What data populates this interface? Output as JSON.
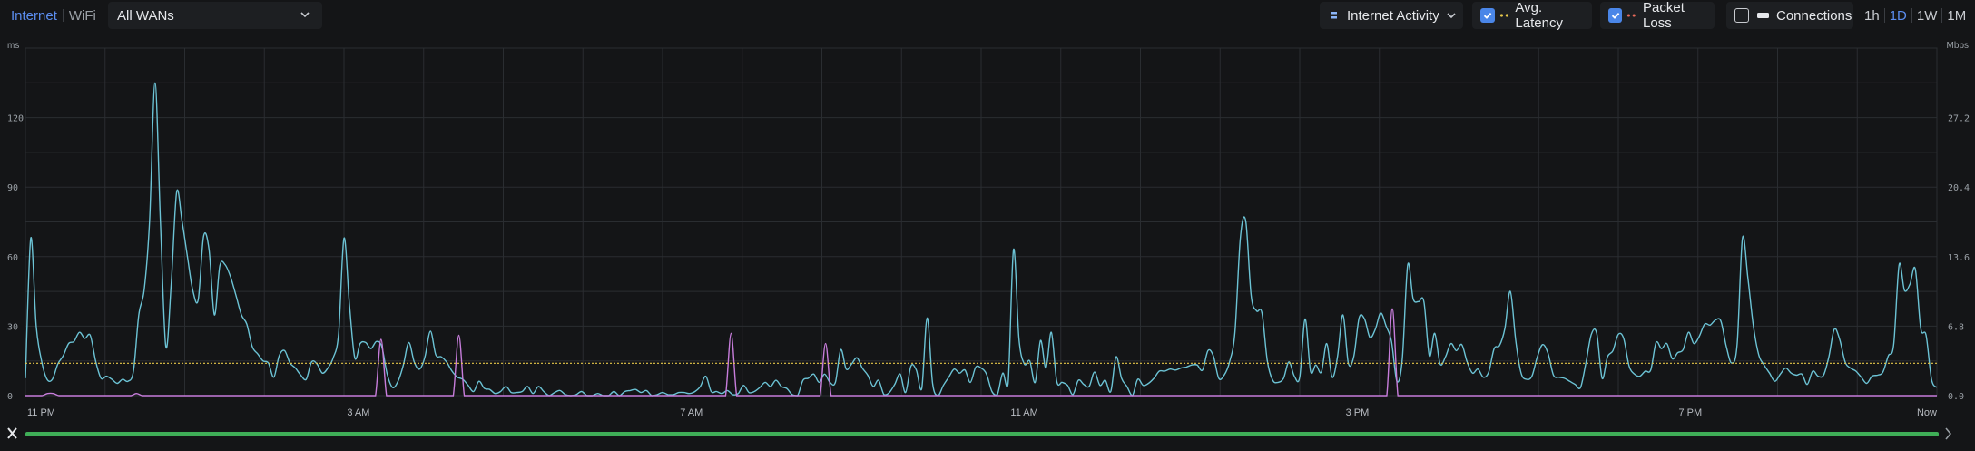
{
  "tabs": [
    {
      "label": "Internet",
      "active": true
    },
    {
      "label": "WiFi",
      "active": false
    }
  ],
  "wan_select": {
    "value": "All WANs"
  },
  "view_select": {
    "value": "Internet Activity"
  },
  "toggles": [
    {
      "label": "Avg. Latency",
      "checked": true,
      "marker_color": "#e8c94a"
    },
    {
      "label": "Packet Loss",
      "checked": true,
      "marker_color": "#e86a5a"
    },
    {
      "label": "Connections",
      "checked": false,
      "marker_color": "#e6e8eb"
    }
  ],
  "ranges": [
    {
      "label": "1h",
      "active": false
    },
    {
      "label": "1D",
      "active": true
    },
    {
      "label": "1W",
      "active": false
    },
    {
      "label": "1M",
      "active": false
    }
  ],
  "chart_data": {
    "type": "line",
    "left_axis": {
      "unit": "ms",
      "ticks": [
        "0",
        "30",
        "60",
        "90",
        "120"
      ],
      "range": [
        0,
        150
      ]
    },
    "right_axis": {
      "unit": "Mbps",
      "ticks": [
        "0.0",
        "6.8",
        "13.6",
        "20.4",
        "27.2"
      ],
      "range": [
        0,
        34
      ]
    },
    "x_axis": {
      "labels": [
        "11 PM",
        "3 AM",
        "7 AM",
        "11 AM",
        "3 PM",
        "7 PM",
        "Now"
      ]
    },
    "grid": true,
    "series": [
      {
        "color": "#6cc3d5",
        "axis": "right",
        "values": [
          1.7,
          15.4,
          6.8,
          3.4,
          1.6,
          1.6,
          3.1,
          3.9,
          5.1,
          5.3,
          6.2,
          5.6,
          5.9,
          3.4,
          1.7,
          1.9,
          1.6,
          1.2,
          1.6,
          1.4,
          2.4,
          7.9,
          10.4,
          17.1,
          30.6,
          17.1,
          4.8,
          10.9,
          19.9,
          17.1,
          13.6,
          10.3,
          9.4,
          15.6,
          14.3,
          7.9,
          12.7,
          12.8,
          11.6,
          9.8,
          7.9,
          7.0,
          4.8,
          4.1,
          3.4,
          3.2,
          1.8,
          3.9,
          4.4,
          3.2,
          2.7,
          2.0,
          1.6,
          3.3,
          3.1,
          2.2,
          2.7,
          3.7,
          6.1,
          15.4,
          9.0,
          3.7,
          5.1,
          5.2,
          4.6,
          5.3,
          4.8,
          2.1,
          0.8,
          1.4,
          3.0,
          5.2,
          3.3,
          2.6,
          3.8,
          6.3,
          4.0,
          3.8,
          3.3,
          2.4,
          1.8,
          1.6,
          1.0,
          0.4,
          1.4,
          0.7,
          0.6,
          0.2,
          0.4,
          0.9,
          0.3,
          0.3,
          0.4,
          0.9,
          0.2,
          0.9,
          0.4,
          0.0,
          0.3,
          0.5,
          0.1,
          0.0,
          0.1,
          0.4,
          0.0,
          0.0,
          0.2,
          0.0,
          0.0,
          0.4,
          0.0,
          0.4,
          0.5,
          0.6,
          0.3,
          0.5,
          0.0,
          0.1,
          0.3,
          0.1,
          0.1,
          0.3,
          0.3,
          0.2,
          0.4,
          0.9,
          1.9,
          0.4,
          0.4,
          0.2,
          0.5,
          0.1,
          0.2,
          1.0,
          0.3,
          0.4,
          0.8,
          1.3,
          0.9,
          1.5,
          0.9,
          0.7,
          0.1,
          0.0,
          1.5,
          1.7,
          2.1,
          1.3,
          2.1,
          1.3,
          1.3,
          4.5,
          2.6,
          3.1,
          3.7,
          2.7,
          2.0,
          0.9,
          1.5,
          0.1,
          0.3,
          1.1,
          2.1,
          0.3,
          2.9,
          2.5,
          0.7,
          7.6,
          1.2,
          0.0,
          1.0,
          1.8,
          2.6,
          2.2,
          2.5,
          1.3,
          2.8,
          2.7,
          2.1,
          0.4,
          0.1,
          2.2,
          1.2,
          14.3,
          5.6,
          3.1,
          3.4,
          1.3,
          5.4,
          2.7,
          6.2,
          1.4,
          1.3,
          1.0,
          0.1,
          1.5,
          1.1,
          0.9,
          2.3,
          1.0,
          1.5,
          0.4,
          3.8,
          1.7,
          0.9,
          0.0,
          1.6,
          1.0,
          1.2,
          1.7,
          2.4,
          2.4,
          2.6,
          2.5,
          2.7,
          2.8,
          3.0,
          3.0,
          2.5,
          4.4,
          3.9,
          1.7,
          2.0,
          3.3,
          6.2,
          15.4,
          17.1,
          9.8,
          8.3,
          8.1,
          3.4,
          1.5,
          1.3,
          1.7,
          3.3,
          1.9,
          1.8,
          7.5,
          2.4,
          3.0,
          2.3,
          5.1,
          1.8,
          3.8,
          7.9,
          3.2,
          3.8,
          7.6,
          7.5,
          5.7,
          6.5,
          8.1,
          6.8,
          5.3,
          1.4,
          3.6,
          12.8,
          9.5,
          9.2,
          9.2,
          3.9,
          6.1,
          3.1,
          3.8,
          5.1,
          4.4,
          5.0,
          3.3,
          2.2,
          2.6,
          1.8,
          2.3,
          4.6,
          4.9,
          6.6,
          10.2,
          5.4,
          2.2,
          1.6,
          1.9,
          3.8,
          5.0,
          4.1,
          2.0,
          1.8,
          1.7,
          1.4,
          1.1,
          0.8,
          3.2,
          6.0,
          6.1,
          1.7,
          3.8,
          4.4,
          6.0,
          5.6,
          2.9,
          2.1,
          1.9,
          2.4,
          2.5,
          5.2,
          4.6,
          5.1,
          3.6,
          4.2,
          4.5,
          6.2,
          5.1,
          5.8,
          7.0,
          6.9,
          7.4,
          7.3,
          4.8,
          3.2,
          5.0,
          15.4,
          11.5,
          6.9,
          4.0,
          3.0,
          2.2,
          1.4,
          2.1,
          2.7,
          2.2,
          2.0,
          2.1,
          1.1,
          2.4,
          1.9,
          2.0,
          3.8,
          6.5,
          5.5,
          3.3,
          2.7,
          2.4,
          1.8,
          1.2,
          1.9,
          2.0,
          2.3,
          3.9,
          5.0,
          12.8,
          10.3,
          10.9,
          12.4,
          6.6,
          5.9,
          1.6,
          0.8
        ]
      },
      {
        "color": "#c77ddb",
        "axis": "right",
        "values": [
          0.0,
          0.0,
          0.0,
          0.0,
          0.2,
          0.2,
          0.0,
          0.0,
          0.0,
          0.0,
          0.0,
          0.0,
          0.0,
          0.0,
          0.0,
          0.0,
          0.0,
          0.0,
          0.0,
          0.0,
          0.2,
          0.0,
          0.0,
          0.0,
          0.0,
          0.0,
          0.0,
          0.0,
          0.0,
          0.0,
          0.0,
          0.0,
          0.0,
          0.0,
          0.0,
          0.0,
          0.0,
          0.0,
          0.0,
          0.0,
          0.0,
          0.0,
          0.0,
          0.0,
          0.0,
          0.0,
          0.0,
          0.0,
          0.0,
          0.0,
          0.0,
          0.0,
          0.0,
          0.0,
          0.0,
          0.0,
          0.0,
          0.0,
          0.0,
          0.0,
          0.0,
          0.0,
          0.0,
          0.0,
          5.5,
          0.0,
          0.0,
          0.0,
          0.0,
          0.0,
          0.0,
          0.0,
          0.0,
          0.0,
          0.0,
          0.0,
          0.0,
          0.0,
          5.9,
          0.0,
          0.0,
          0.0,
          0.0,
          0.0,
          0.0,
          0.0,
          0.0,
          0.0,
          0.0,
          0.0,
          0.0,
          0.0,
          0.0,
          0.0,
          0.0,
          0.0,
          0.0,
          0.0,
          0.0,
          0.0,
          0.0,
          0.0,
          0.0,
          0.0,
          0.0,
          0.0,
          0.0,
          0.0,
          0.0,
          0.0,
          0.0,
          0.0,
          0.0,
          0.0,
          0.0,
          0.0,
          0.0,
          0.0,
          0.0,
          0.0,
          0.0,
          0.0,
          0.0,
          0.0,
          0.0,
          0.0,
          0.0,
          6.1,
          0.0,
          0.0,
          0.0,
          0.0,
          0.0,
          0.0,
          0.0,
          0.0,
          0.0,
          0.0,
          0.0,
          0.0,
          0.0,
          0.0,
          0.0,
          0.0,
          5.1,
          0.0,
          0.0,
          0.0,
          0.0,
          0.0,
          0.0,
          0.0,
          0.0,
          0.0,
          0.0,
          0.0,
          0.0,
          0.0,
          0.0,
          0.0,
          0.0,
          0.0,
          0.0,
          0.0,
          0.0,
          0.0,
          0.0,
          0.0,
          0.0,
          0.0,
          0.0,
          0.0,
          0.0,
          0.0,
          0.0,
          0.0,
          0.0,
          0.0,
          0.0,
          0.0,
          0.0,
          0.0,
          0.0,
          0.0,
          0.0,
          0.0,
          0.0,
          0.0,
          0.0,
          0.0,
          0.0,
          0.0,
          0.0,
          0.0,
          0.0,
          0.0,
          0.0,
          0.0,
          0.0,
          0.0,
          0.0,
          0.0,
          0.0,
          0.0,
          0.0,
          0.0,
          0.0,
          0.0,
          0.0,
          0.0,
          0.0,
          0.0,
          0.0,
          0.0,
          0.0,
          0.0,
          0.0,
          0.0,
          0.0,
          0.0,
          0.0,
          0.0,
          0.0,
          0.0,
          0.0,
          0.0,
          0.0,
          0.0,
          0.0,
          0.0,
          0.0,
          0.0,
          0.0,
          0.0,
          0.0,
          0.0,
          0.0,
          0.0,
          0.0,
          0.0,
          0.0,
          0.0,
          0.0,
          0.0,
          0.0,
          0.0,
          8.5,
          0.0,
          0.0,
          0.0,
          0.0,
          0.0,
          0.0,
          0.0,
          0.0,
          0.0,
          0.0,
          0.0,
          0.0,
          0.0,
          0.0,
          0.0,
          0.0,
          0.0,
          0.0,
          0.0,
          0.0,
          0.0,
          0.0,
          0.0,
          0.0,
          0.0,
          0.0,
          0.0,
          0.0,
          0.0,
          0.0,
          0.0,
          0.0,
          0.0,
          0.0,
          0.0,
          0.0,
          0.0,
          0.0,
          0.0,
          0.0,
          0.0,
          0.0,
          0.0,
          0.0,
          0.0,
          0.0,
          0.0,
          0.0,
          0.0,
          0.0,
          0.0,
          0.0,
          0.0,
          0.0,
          0.0,
          0.0,
          0.0,
          0.0,
          0.0,
          0.0,
          0.0,
          0.0,
          0.0,
          0.0,
          0.0,
          0.0,
          0.0,
          0.0,
          0.0,
          0.0,
          0.0,
          0.0,
          0.0,
          0.0,
          0.0,
          0.0,
          0.0,
          0.0,
          0.0,
          0.0,
          0.0,
          0.0,
          0.0,
          0.0,
          0.0,
          0.0,
          0.0,
          0.0,
          0.0,
          0.0,
          0.0,
          0.0,
          0.0,
          0.0,
          0.0,
          0.0,
          0.0,
          0.0
        ]
      },
      {
        "color": "#e8c94a",
        "axis": "left",
        "dashed": true,
        "values": [
          14,
          14,
          14,
          14,
          14,
          14,
          14,
          14,
          14,
          14,
          14,
          14,
          14,
          14,
          14,
          14,
          14,
          14,
          14,
          14,
          14,
          14,
          14,
          14,
          14,
          14,
          14,
          14,
          14,
          14,
          14,
          14,
          14,
          14,
          14,
          14,
          14,
          14,
          14,
          14,
          14,
          14,
          14,
          14,
          14,
          14,
          14,
          14,
          14,
          14,
          14,
          14,
          14,
          14,
          14,
          14,
          14,
          14,
          14,
          14,
          14,
          14,
          14,
          14,
          14,
          14,
          14,
          14,
          14,
          14,
          14,
          14,
          14,
          14,
          14,
          14,
          14,
          14,
          14,
          14,
          14,
          14,
          14,
          14,
          14,
          14,
          14,
          14,
          14,
          14,
          14,
          14,
          14,
          14,
          14,
          14,
          14,
          14,
          14,
          14,
          14,
          14,
          14,
          14,
          14,
          14,
          14,
          14,
          14,
          14,
          14,
          14,
          14,
          14,
          14,
          14,
          14,
          14,
          14,
          14,
          14,
          14,
          14,
          14,
          14,
          14,
          14,
          14,
          14,
          14,
          14,
          14,
          14,
          14,
          14,
          14,
          14,
          14,
          14,
          14,
          14,
          14,
          14,
          14,
          14,
          14,
          14,
          14,
          14,
          14,
          14,
          14,
          14,
          14,
          14,
          14,
          14,
          14,
          14,
          14,
          14,
          14,
          14,
          14,
          14,
          14,
          14,
          14,
          14,
          14,
          14,
          14,
          14,
          14,
          14,
          14,
          14,
          14,
          14,
          14,
          14,
          14,
          14,
          14,
          14,
          14,
          14,
          14,
          14,
          14,
          14,
          14,
          14,
          14,
          14,
          14,
          14,
          14,
          14,
          14,
          14,
          14,
          14,
          14,
          14,
          14,
          14,
          14,
          14,
          14,
          14,
          14,
          14,
          14,
          14,
          14,
          14,
          14,
          14,
          14,
          14,
          14,
          14,
          14,
          14,
          14,
          14,
          14,
          14,
          14,
          14,
          14,
          14,
          14,
          14,
          14,
          14,
          14,
          14,
          14,
          14,
          14,
          14,
          14,
          14,
          14,
          14,
          14,
          14,
          14,
          14,
          14,
          14,
          14,
          14,
          14,
          14,
          14,
          14,
          14,
          14,
          14,
          14,
          14,
          14,
          14,
          14,
          14,
          14,
          14,
          14,
          14,
          14,
          14,
          14,
          14,
          14,
          14,
          14,
          14,
          14,
          14,
          14,
          14,
          14,
          14,
          14,
          14,
          14,
          14,
          14,
          14,
          14,
          14,
          14,
          14,
          14,
          14,
          14,
          14,
          14,
          14,
          14,
          14,
          14,
          14,
          14,
          14,
          14,
          14,
          14,
          14,
          14,
          14,
          14,
          14,
          14,
          14,
          14,
          14,
          14,
          14,
          14,
          14,
          14,
          14,
          14,
          14,
          14,
          14,
          14,
          14,
          14,
          14,
          14,
          14,
          14,
          14,
          14,
          14,
          14,
          14,
          14,
          14,
          14,
          14,
          14,
          14
        ]
      }
    ]
  },
  "scrubber": {
    "color": "#3fae57"
  }
}
